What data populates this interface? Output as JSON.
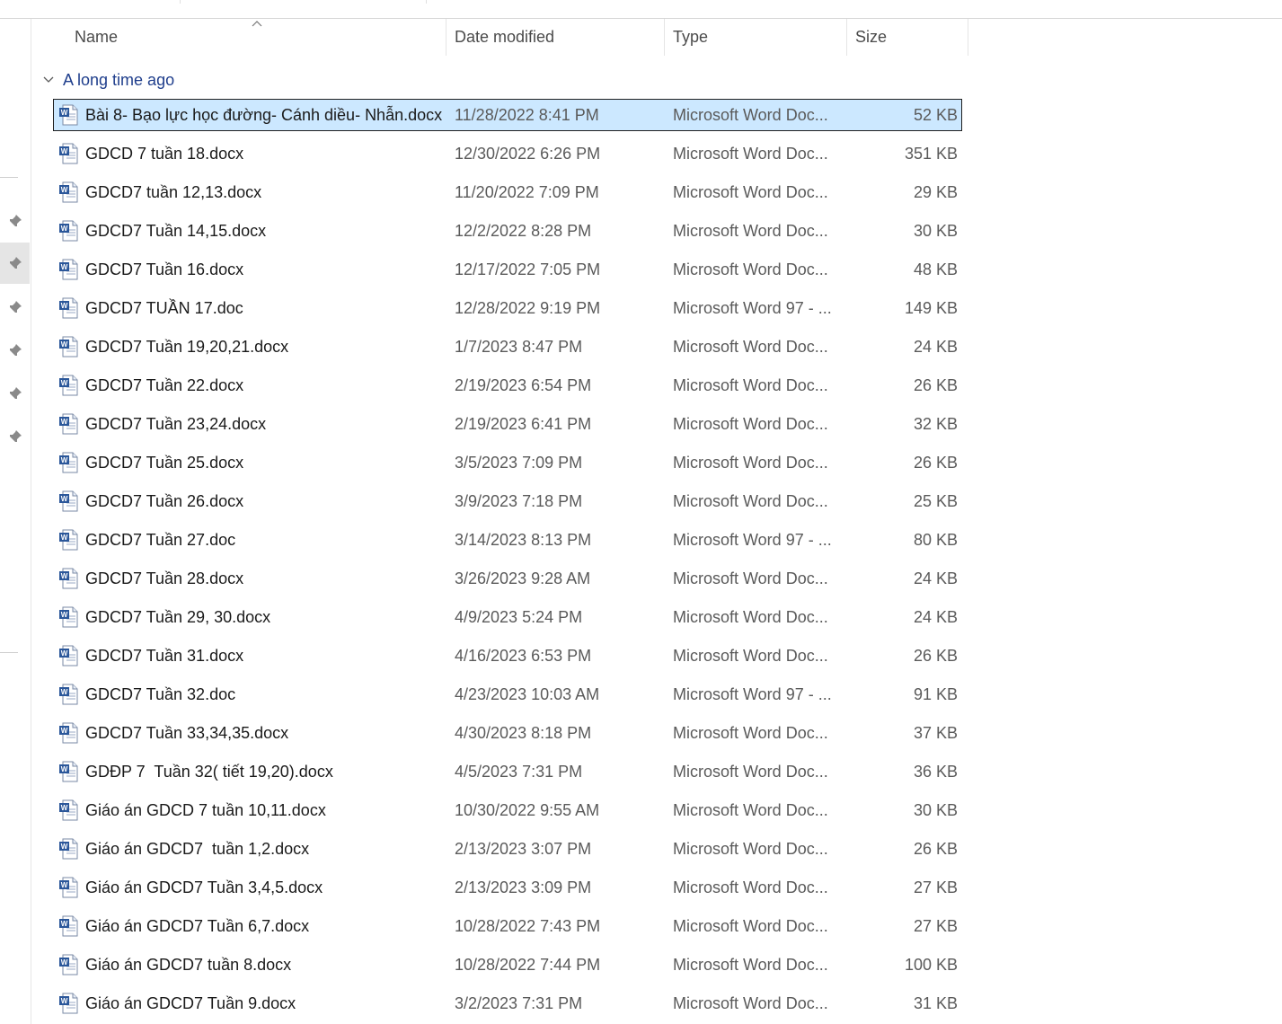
{
  "columns": {
    "name": "Name",
    "date": "Date modified",
    "type": "Type",
    "size": "Size"
  },
  "group": {
    "label": "A long time ago"
  },
  "colors": {
    "accent_blue": "#1f3e8c",
    "selection": "#cce8ff",
    "word_blue": "#2b579a"
  },
  "files": [
    {
      "name": "Bài 8- Bạo lực học đường- Cánh diều- Nhẫn.docx",
      "date": "11/28/2022 8:41 PM",
      "type": "Microsoft Word Doc...",
      "size": "52 KB",
      "icon": "docx-icon",
      "selected": true
    },
    {
      "name": "GDCD 7 tuần 18.docx",
      "date": "12/30/2022 6:26 PM",
      "type": "Microsoft Word Doc...",
      "size": "351 KB",
      "icon": "docx-icon"
    },
    {
      "name": "GDCD7 tuần 12,13.docx",
      "date": "11/20/2022 7:09 PM",
      "type": "Microsoft Word Doc...",
      "size": "29 KB",
      "icon": "docx-icon"
    },
    {
      "name": "GDCD7 Tuần 14,15.docx",
      "date": "12/2/2022 8:28 PM",
      "type": "Microsoft Word Doc...",
      "size": "30 KB",
      "icon": "docx-icon"
    },
    {
      "name": "GDCD7 Tuần 16.docx",
      "date": "12/17/2022 7:05 PM",
      "type": "Microsoft Word Doc...",
      "size": "48 KB",
      "icon": "docx-icon"
    },
    {
      "name": "GDCD7 TUẦN 17.doc",
      "date": "12/28/2022 9:19 PM",
      "type": "Microsoft Word 97 - ...",
      "size": "149 KB",
      "icon": "doc-icon"
    },
    {
      "name": "GDCD7 Tuần 19,20,21.docx",
      "date": "1/7/2023 8:47 PM",
      "type": "Microsoft Word Doc...",
      "size": "24 KB",
      "icon": "docx-icon"
    },
    {
      "name": "GDCD7 Tuần 22.docx",
      "date": "2/19/2023 6:54 PM",
      "type": "Microsoft Word Doc...",
      "size": "26 KB",
      "icon": "docx-icon"
    },
    {
      "name": "GDCD7 Tuần 23,24.docx",
      "date": "2/19/2023 6:41 PM",
      "type": "Microsoft Word Doc...",
      "size": "32 KB",
      "icon": "docx-icon"
    },
    {
      "name": "GDCD7 Tuần 25.docx",
      "date": "3/5/2023 7:09 PM",
      "type": "Microsoft Word Doc...",
      "size": "26 KB",
      "icon": "docx-icon"
    },
    {
      "name": "GDCD7 Tuần 26.docx",
      "date": "3/9/2023 7:18 PM",
      "type": "Microsoft Word Doc...",
      "size": "25 KB",
      "icon": "docx-icon"
    },
    {
      "name": "GDCD7 Tuần 27.doc",
      "date": "3/14/2023 8:13 PM",
      "type": "Microsoft Word 97 - ...",
      "size": "80 KB",
      "icon": "doc-icon"
    },
    {
      "name": "GDCD7 Tuần 28.docx",
      "date": "3/26/2023 9:28 AM",
      "type": "Microsoft Word Doc...",
      "size": "24 KB",
      "icon": "docx-icon"
    },
    {
      "name": "GDCD7 Tuần 29, 30.docx",
      "date": "4/9/2023 5:24 PM",
      "type": "Microsoft Word Doc...",
      "size": "24 KB",
      "icon": "docx-icon"
    },
    {
      "name": "GDCD7 Tuần 31.docx",
      "date": "4/16/2023 6:53 PM",
      "type": "Microsoft Word Doc...",
      "size": "26 KB",
      "icon": "docx-icon"
    },
    {
      "name": "GDCD7 Tuần 32.doc",
      "date": "4/23/2023 10:03 AM",
      "type": "Microsoft Word 97 - ...",
      "size": "91 KB",
      "icon": "doc-icon"
    },
    {
      "name": "GDCD7 Tuần 33,34,35.docx",
      "date": "4/30/2023 8:18 PM",
      "type": "Microsoft Word Doc...",
      "size": "37 KB",
      "icon": "docx-icon"
    },
    {
      "name": "GDĐP 7  Tuần 32( tiết 19,20).docx",
      "date": "4/5/2023 7:31 PM",
      "type": "Microsoft Word Doc...",
      "size": "36 KB",
      "icon": "docx-icon"
    },
    {
      "name": "Giáo án GDCD 7 tuần 10,11.docx",
      "date": "10/30/2022 9:55 AM",
      "type": "Microsoft Word Doc...",
      "size": "30 KB",
      "icon": "docx-icon"
    },
    {
      "name": "Giáo án GDCD7  tuần 1,2.docx",
      "date": "2/13/2023 3:07 PM",
      "type": "Microsoft Word Doc...",
      "size": "26 KB",
      "icon": "docx-icon"
    },
    {
      "name": "Giáo án GDCD7 Tuần 3,4,5.docx",
      "date": "2/13/2023 3:09 PM",
      "type": "Microsoft Word Doc...",
      "size": "27 KB",
      "icon": "docx-icon"
    },
    {
      "name": "Giáo án GDCD7 Tuần 6,7.docx",
      "date": "10/28/2022 7:43 PM",
      "type": "Microsoft Word Doc...",
      "size": "27 KB",
      "icon": "docx-icon"
    },
    {
      "name": "Giáo án GDCD7 tuần 8.docx",
      "date": "10/28/2022 7:44 PM",
      "type": "Microsoft Word Doc...",
      "size": "100 KB",
      "icon": "docx-icon"
    },
    {
      "name": "Giáo án GDCD7 Tuần 9.docx",
      "date": "3/2/2023 7:31 PM",
      "type": "Microsoft Word Doc...",
      "size": "31 KB",
      "icon": "docx-icon"
    }
  ]
}
